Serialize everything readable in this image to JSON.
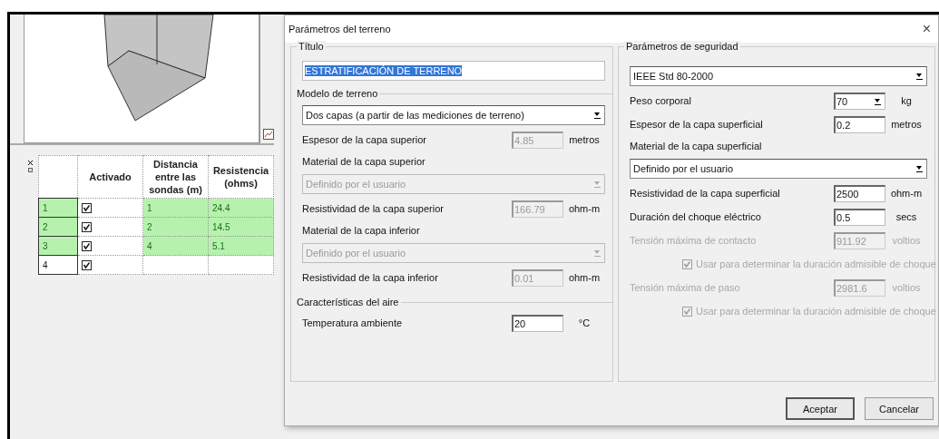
{
  "app": {
    "table": {
      "columns": [
        "Activado",
        "Distancia entre las sondas (m)",
        "Resistencia (ohms)"
      ],
      "rows": [
        {
          "number": "1",
          "activated": true,
          "distance": "1",
          "resistance": "24.4",
          "highlighted": true
        },
        {
          "number": "2",
          "activated": true,
          "distance": "2",
          "resistance": "14.5",
          "highlighted": true
        },
        {
          "number": "3",
          "activated": true,
          "distance": "4",
          "resistance": "5.1",
          "highlighted": true
        },
        {
          "number": "4",
          "activated": true,
          "highlighted": false
        }
      ]
    }
  },
  "dialog": {
    "title": "Parámetros del terreno",
    "close": "×",
    "left": {
      "legend": "Título",
      "title_field": {
        "value": "ESTRATIFICACIÓN DE TERRENO",
        "selected": true
      },
      "sections": [
        {
          "heading": "Modelo de terreno",
          "rows": [
            {
              "kind": "select",
              "value": "Dos capas (a partir de las mediciones de terreno)",
              "disabled": false
            },
            {
              "kind": "field",
              "label": "Espesor de la capa superior",
              "value": "4.85",
              "unit": "metros",
              "disabled": true,
              "dimmed": false
            },
            {
              "kind": "label",
              "label": "Material de la capa superior",
              "dimmed": false
            },
            {
              "kind": "select",
              "value": "Definido por el usuario",
              "disabled": true
            },
            {
              "kind": "field",
              "label": "Resistividad de la capa superior",
              "value": "166.79",
              "unit": "ohm-m",
              "disabled": true,
              "dimmed": false
            },
            {
              "kind": "label",
              "label": "Material de la capa inferior",
              "dimmed": false
            },
            {
              "kind": "select",
              "value": "Definido por el usuario",
              "disabled": true
            },
            {
              "kind": "field",
              "label": "Resistividad de la capa inferior",
              "value": "0.01",
              "unit": "ohm-m",
              "disabled": true,
              "dimmed": false
            }
          ]
        },
        {
          "heading": "Características del aire",
          "rows": [
            {
              "kind": "field",
              "label": "Temperatura ambiente",
              "value": "20",
              "unit": "°C",
              "disabled": false,
              "dimmed": false
            }
          ]
        }
      ]
    },
    "right": {
      "legend": "Parámetros de seguridad",
      "rows": [
        {
          "kind": "select",
          "value": "IEEE Std 80-2000",
          "disabled": false
        },
        {
          "kind": "combo",
          "label": "Peso corporal",
          "value": "70",
          "unit": "kg",
          "disabled": false,
          "dimmed": false
        },
        {
          "kind": "field",
          "label": "Espesor de la capa superficial",
          "value": "0.2",
          "unit": "metros",
          "disabled": false,
          "dimmed": false
        },
        {
          "kind": "label",
          "label": "Material de la capa superficial",
          "dimmed": false
        },
        {
          "kind": "select",
          "value": "Definido por el usuario",
          "disabled": false
        },
        {
          "kind": "field",
          "label": "Resistividad de la capa superficial",
          "value": "2500",
          "unit": "ohm-m",
          "disabled": false,
          "dimmed": false
        },
        {
          "kind": "field",
          "label": "Duración del choque eléctrico",
          "value": "0.5",
          "unit": "secs",
          "disabled": false,
          "dimmed": false
        },
        {
          "kind": "field",
          "label": "Tensión máxima de contacto",
          "value": "911.92",
          "unit": "voltios",
          "disabled": true,
          "dimmed": true
        },
        {
          "kind": "checkbox",
          "label": "Usar para determinar la duración admisible de choque",
          "checked": true,
          "disabled": true
        },
        {
          "kind": "field",
          "label": "Tensión máxima de paso",
          "value": "2981.6",
          "unit": "voltios",
          "disabled": true,
          "dimmed": true
        },
        {
          "kind": "checkbox",
          "label": "Usar para determinar la duración admisible de choque",
          "checked": true,
          "disabled": true
        }
      ]
    },
    "buttons": [
      {
        "label": "Aceptar",
        "default": true
      },
      {
        "label": "Cancelar",
        "default": false
      }
    ]
  }
}
